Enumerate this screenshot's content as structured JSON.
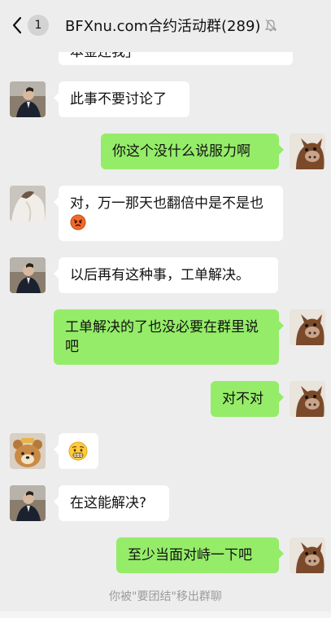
{
  "header": {
    "unread_count": "1",
    "title": "BFXnu.com合约活动群(289)"
  },
  "messages": [
    {
      "side": "left",
      "text": "本金还我」",
      "avatar": "man-avatar"
    },
    {
      "side": "left",
      "text": "此事不要讨论了",
      "avatar": "man-avatar"
    },
    {
      "side": "right",
      "text": "你这个没什么说服力啊",
      "avatar": "donkey-avatar"
    },
    {
      "side": "left",
      "text": "对，万一那天也翻倍中是不是也",
      "emoji": "angry-face-emoji",
      "avatar": "woman-avatar"
    },
    {
      "side": "left",
      "text": "以后再有这种事，工单解决。",
      "avatar": "man-avatar"
    },
    {
      "side": "right",
      "text": "工单解决的了也没必要在群里说吧",
      "avatar": "donkey-avatar"
    },
    {
      "side": "right",
      "text": "对不对",
      "avatar": "donkey-avatar"
    },
    {
      "side": "left",
      "emoji": "grimace-face-emoji",
      "avatar": "bear-avatar"
    },
    {
      "side": "left",
      "text": "在这能解决?",
      "avatar": "man-avatar"
    },
    {
      "side": "right",
      "text": "至少当面对峙一下吧",
      "avatar": "donkey-avatar"
    }
  ],
  "system_message": "你被\"要团结\"移出群聊",
  "colors": {
    "background": "#ededed",
    "left_bubble": "#ffffff",
    "right_bubble": "#95ec69",
    "system_text": "#9b9b9b"
  }
}
